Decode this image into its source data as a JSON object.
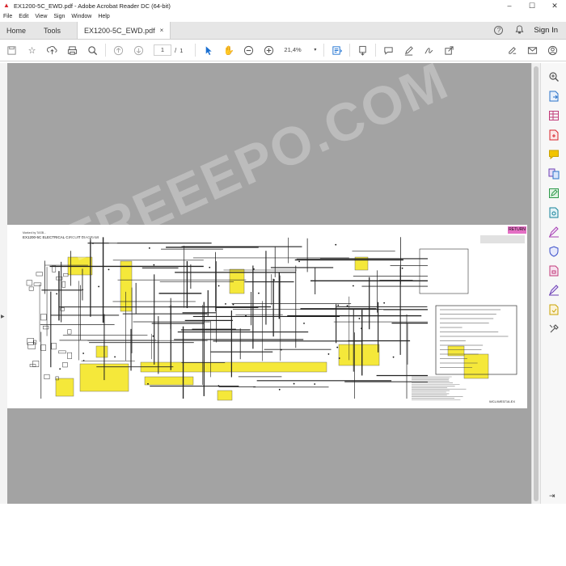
{
  "window": {
    "title": "EX1200-5C_EWD.pdf - Adobe Acrobat Reader DC (64-bit)",
    "minimize": "–",
    "maximize": "☐",
    "close": "✕"
  },
  "menu": {
    "items": [
      "File",
      "Edit",
      "View",
      "Sign",
      "Window",
      "Help"
    ]
  },
  "tabs": {
    "home": "Home",
    "tools": "Tools",
    "document": "EX1200-5C_EWD.pdf",
    "close": "×",
    "sign_in": "Sign In",
    "help_icon": "?",
    "bell_icon": "🔔"
  },
  "toolbar": {
    "current_page": "1",
    "page_separator": "/",
    "total_pages": "1",
    "zoom": "21,4%"
  },
  "document": {
    "return_label": "RETURN",
    "diagram_title": "EX1200-5C ELECTRICAL CIRCUIT DIAGRAM",
    "diagram_note": "Marked by TASB...",
    "diagram_code": "WCL/WE5716-EX",
    "watermark": "FREEEPO.COM"
  },
  "colors": {
    "accent": "#1a6fd1",
    "viewport_bg": "#a3a3a3",
    "highlight_yellow": "#f5e83a",
    "return_pink": "#e46fc4"
  },
  "icons": {
    "toolbar": [
      "save-icon",
      "bookmark-star-icon",
      "upload-icon",
      "print-icon",
      "search-icon",
      "prev-page-icon",
      "next-page-icon",
      "select-cursor-icon",
      "hand-icon",
      "zoom-out-icon",
      "zoom-in-icon",
      "fit-page-icon",
      "scroll-mode-icon",
      "comment-icon",
      "pen-icon",
      "sign-icon",
      "share-icon",
      "link-icon",
      "mail-icon",
      "account-icon"
    ],
    "rail": [
      "zoom-tool-icon",
      "export-pdf-icon",
      "organize-pages-icon",
      "create-pdf-icon",
      "comment-tool-icon",
      "combine-files-icon",
      "edit-pdf-icon",
      "scan-icon",
      "fill-sign-icon",
      "protect-icon",
      "send-icon",
      "pen-tool-icon",
      "certificate-icon",
      "more-tools-icon"
    ]
  }
}
